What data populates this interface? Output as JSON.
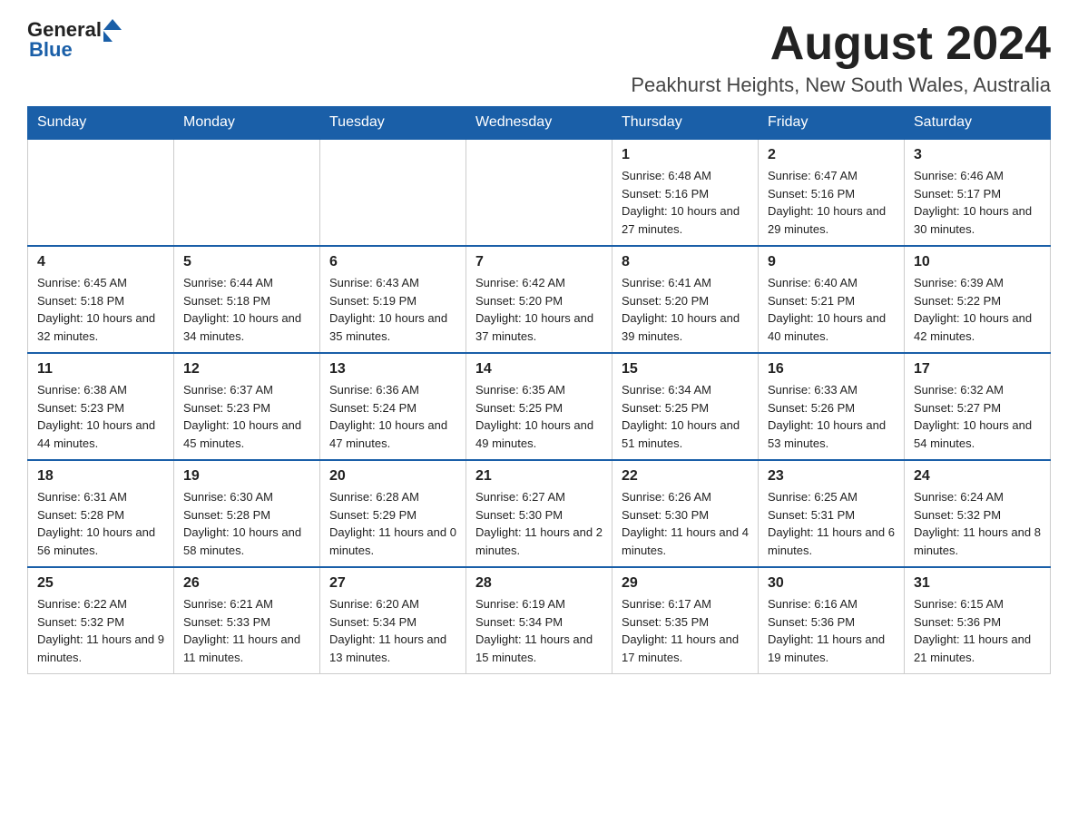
{
  "header": {
    "logo_general": "General",
    "logo_blue": "Blue",
    "month_title": "August 2024",
    "location": "Peakhurst Heights, New South Wales, Australia"
  },
  "days_of_week": [
    "Sunday",
    "Monday",
    "Tuesday",
    "Wednesday",
    "Thursday",
    "Friday",
    "Saturday"
  ],
  "weeks": [
    [
      {
        "day": "",
        "info": ""
      },
      {
        "day": "",
        "info": ""
      },
      {
        "day": "",
        "info": ""
      },
      {
        "day": "",
        "info": ""
      },
      {
        "day": "1",
        "info": "Sunrise: 6:48 AM\nSunset: 5:16 PM\nDaylight: 10 hours and 27 minutes."
      },
      {
        "day": "2",
        "info": "Sunrise: 6:47 AM\nSunset: 5:16 PM\nDaylight: 10 hours and 29 minutes."
      },
      {
        "day": "3",
        "info": "Sunrise: 6:46 AM\nSunset: 5:17 PM\nDaylight: 10 hours and 30 minutes."
      }
    ],
    [
      {
        "day": "4",
        "info": "Sunrise: 6:45 AM\nSunset: 5:18 PM\nDaylight: 10 hours and 32 minutes."
      },
      {
        "day": "5",
        "info": "Sunrise: 6:44 AM\nSunset: 5:18 PM\nDaylight: 10 hours and 34 minutes."
      },
      {
        "day": "6",
        "info": "Sunrise: 6:43 AM\nSunset: 5:19 PM\nDaylight: 10 hours and 35 minutes."
      },
      {
        "day": "7",
        "info": "Sunrise: 6:42 AM\nSunset: 5:20 PM\nDaylight: 10 hours and 37 minutes."
      },
      {
        "day": "8",
        "info": "Sunrise: 6:41 AM\nSunset: 5:20 PM\nDaylight: 10 hours and 39 minutes."
      },
      {
        "day": "9",
        "info": "Sunrise: 6:40 AM\nSunset: 5:21 PM\nDaylight: 10 hours and 40 minutes."
      },
      {
        "day": "10",
        "info": "Sunrise: 6:39 AM\nSunset: 5:22 PM\nDaylight: 10 hours and 42 minutes."
      }
    ],
    [
      {
        "day": "11",
        "info": "Sunrise: 6:38 AM\nSunset: 5:23 PM\nDaylight: 10 hours and 44 minutes."
      },
      {
        "day": "12",
        "info": "Sunrise: 6:37 AM\nSunset: 5:23 PM\nDaylight: 10 hours and 45 minutes."
      },
      {
        "day": "13",
        "info": "Sunrise: 6:36 AM\nSunset: 5:24 PM\nDaylight: 10 hours and 47 minutes."
      },
      {
        "day": "14",
        "info": "Sunrise: 6:35 AM\nSunset: 5:25 PM\nDaylight: 10 hours and 49 minutes."
      },
      {
        "day": "15",
        "info": "Sunrise: 6:34 AM\nSunset: 5:25 PM\nDaylight: 10 hours and 51 minutes."
      },
      {
        "day": "16",
        "info": "Sunrise: 6:33 AM\nSunset: 5:26 PM\nDaylight: 10 hours and 53 minutes."
      },
      {
        "day": "17",
        "info": "Sunrise: 6:32 AM\nSunset: 5:27 PM\nDaylight: 10 hours and 54 minutes."
      }
    ],
    [
      {
        "day": "18",
        "info": "Sunrise: 6:31 AM\nSunset: 5:28 PM\nDaylight: 10 hours and 56 minutes."
      },
      {
        "day": "19",
        "info": "Sunrise: 6:30 AM\nSunset: 5:28 PM\nDaylight: 10 hours and 58 minutes."
      },
      {
        "day": "20",
        "info": "Sunrise: 6:28 AM\nSunset: 5:29 PM\nDaylight: 11 hours and 0 minutes."
      },
      {
        "day": "21",
        "info": "Sunrise: 6:27 AM\nSunset: 5:30 PM\nDaylight: 11 hours and 2 minutes."
      },
      {
        "day": "22",
        "info": "Sunrise: 6:26 AM\nSunset: 5:30 PM\nDaylight: 11 hours and 4 minutes."
      },
      {
        "day": "23",
        "info": "Sunrise: 6:25 AM\nSunset: 5:31 PM\nDaylight: 11 hours and 6 minutes."
      },
      {
        "day": "24",
        "info": "Sunrise: 6:24 AM\nSunset: 5:32 PM\nDaylight: 11 hours and 8 minutes."
      }
    ],
    [
      {
        "day": "25",
        "info": "Sunrise: 6:22 AM\nSunset: 5:32 PM\nDaylight: 11 hours and 9 minutes."
      },
      {
        "day": "26",
        "info": "Sunrise: 6:21 AM\nSunset: 5:33 PM\nDaylight: 11 hours and 11 minutes."
      },
      {
        "day": "27",
        "info": "Sunrise: 6:20 AM\nSunset: 5:34 PM\nDaylight: 11 hours and 13 minutes."
      },
      {
        "day": "28",
        "info": "Sunrise: 6:19 AM\nSunset: 5:34 PM\nDaylight: 11 hours and 15 minutes."
      },
      {
        "day": "29",
        "info": "Sunrise: 6:17 AM\nSunset: 5:35 PM\nDaylight: 11 hours and 17 minutes."
      },
      {
        "day": "30",
        "info": "Sunrise: 6:16 AM\nSunset: 5:36 PM\nDaylight: 11 hours and 19 minutes."
      },
      {
        "day": "31",
        "info": "Sunrise: 6:15 AM\nSunset: 5:36 PM\nDaylight: 11 hours and 21 minutes."
      }
    ]
  ]
}
